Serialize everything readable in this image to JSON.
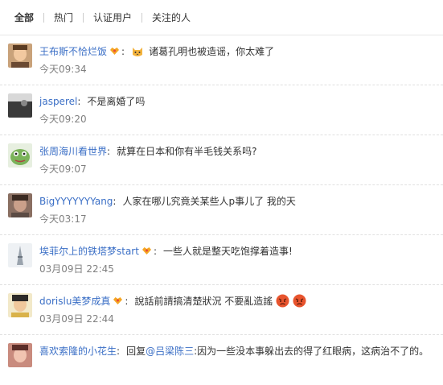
{
  "tabs": [
    "全部",
    "热门",
    "认证用户",
    "关注的人"
  ],
  "active_tab": 0,
  "comments": [
    {
      "user": "王布斯不恰烂饭",
      "vip": true,
      "emoji_before": "cat",
      "text": "诸葛孔明也被造谣，你太难了",
      "time": "今天09:34"
    },
    {
      "user": "jasperel",
      "vip": false,
      "text": "不是离婚了吗",
      "time": "今天09:20"
    },
    {
      "user": "张周海川看世界",
      "vip": false,
      "text": "就算在日本和你有半毛钱关系吗?",
      "time": "今天09:07"
    },
    {
      "user": "BigYYYYYYYang",
      "vip": false,
      "text": "人家在哪儿究竟关某些人p事儿了 我的天",
      "time": "今天03:17"
    },
    {
      "user": "埃菲尔上的铁塔梦start",
      "vip": true,
      "text": "一些人就是整天吃饱撑着造事!",
      "time": "03月09日 22:45"
    },
    {
      "user": "dorislu美梦成真",
      "vip": true,
      "text": "說話前請搞清楚狀況 不要亂造謠",
      "emoji_after": [
        "angry",
        "angry"
      ],
      "time": "03月09日 22:44"
    },
    {
      "user": "喜欢索隆的小花生",
      "vip": false,
      "reply_prefix": "回复",
      "mention": "@吕梁陈三",
      "text": ":因为一些没本事躲出去的得了红眼病，这病治不了的。",
      "time": ""
    }
  ],
  "colors": {
    "username": "#eb7350",
    "link": "#3b6fc6",
    "time": "#808080"
  }
}
